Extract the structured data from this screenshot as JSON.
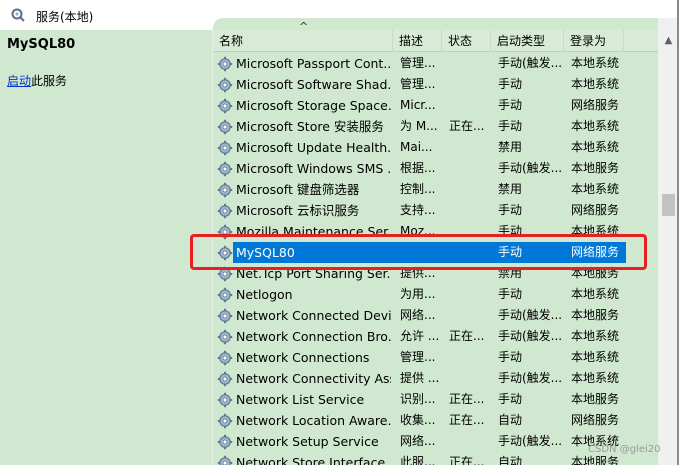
{
  "window": {
    "title": "服务(本地)"
  },
  "left": {
    "service_name": "MySQL80",
    "start_link": "启动",
    "start_suffix": "此服务"
  },
  "columns": [
    "名称",
    "描述",
    "状态",
    "启动类型",
    "登录为"
  ],
  "services": [
    {
      "name": "Microsoft Passport Cont...",
      "desc": "管理...",
      "status": "",
      "startup": "手动(触发...",
      "logon": "本地系统"
    },
    {
      "name": "Microsoft Software Shad...",
      "desc": "管理...",
      "status": "",
      "startup": "手动",
      "logon": "本地系统"
    },
    {
      "name": "Microsoft Storage Space...",
      "desc": "Micr...",
      "status": "",
      "startup": "手动",
      "logon": "网络服务"
    },
    {
      "name": "Microsoft Store 安装服务",
      "desc": "为 M...",
      "status": "正在...",
      "startup": "手动",
      "logon": "本地系统"
    },
    {
      "name": "Microsoft Update Health...",
      "desc": "Mai...",
      "status": "",
      "startup": "禁用",
      "logon": "本地系统"
    },
    {
      "name": "Microsoft Windows SMS ...",
      "desc": "根据...",
      "status": "",
      "startup": "手动(触发...",
      "logon": "本地服务"
    },
    {
      "name": "Microsoft 键盘筛选器",
      "desc": "控制...",
      "status": "",
      "startup": "禁用",
      "logon": "本地系统"
    },
    {
      "name": "Microsoft 云标识服务",
      "desc": "支持...",
      "status": "",
      "startup": "手动",
      "logon": "网络服务"
    },
    {
      "name": "Mozilla Maintenance Ser...",
      "desc": "Moz...",
      "status": "",
      "startup": "手动",
      "logon": "本地系统"
    },
    {
      "name": "MySQL80",
      "desc": "",
      "status": "",
      "startup": "手动",
      "logon": "网络服务",
      "selected": true
    },
    {
      "name": "Net.Tcp Port Sharing Ser...",
      "desc": "提供...",
      "status": "",
      "startup": "禁用",
      "logon": "本地服务"
    },
    {
      "name": "Netlogon",
      "desc": "为用...",
      "status": "",
      "startup": "手动",
      "logon": "本地系统"
    },
    {
      "name": "Network Connected Devi...",
      "desc": "网络...",
      "status": "",
      "startup": "手动(触发...",
      "logon": "本地服务"
    },
    {
      "name": "Network Connection Bro...",
      "desc": "允许 ...",
      "status": "正在...",
      "startup": "手动(触发...",
      "logon": "本地系统"
    },
    {
      "name": "Network Connections",
      "desc": "管理...",
      "status": "",
      "startup": "手动",
      "logon": "本地系统"
    },
    {
      "name": "Network Connectivity Ass...",
      "desc": "提供 ...",
      "status": "",
      "startup": "手动(触发...",
      "logon": "本地系统"
    },
    {
      "name": "Network List Service",
      "desc": "识别...",
      "status": "正在...",
      "startup": "手动",
      "logon": "本地服务"
    },
    {
      "name": "Network Location Aware...",
      "desc": "收集...",
      "status": "正在...",
      "startup": "自动",
      "logon": "网络服务"
    },
    {
      "name": "Network Setup Service",
      "desc": "网络...",
      "status": "",
      "startup": "手动(触发...",
      "logon": "本地系统"
    },
    {
      "name": "Network Store Interface ...",
      "desc": "此服...",
      "status": "正在...",
      "startup": "自动",
      "logon": "本地服务"
    }
  ],
  "watermark": "CSDN @glei20",
  "icons": {
    "title": "gear-search-icon",
    "service": "gear-icon"
  },
  "colors": {
    "pane_bg": "#cfe8cf",
    "selection": "#0078d7",
    "highlight": "#e82020"
  }
}
